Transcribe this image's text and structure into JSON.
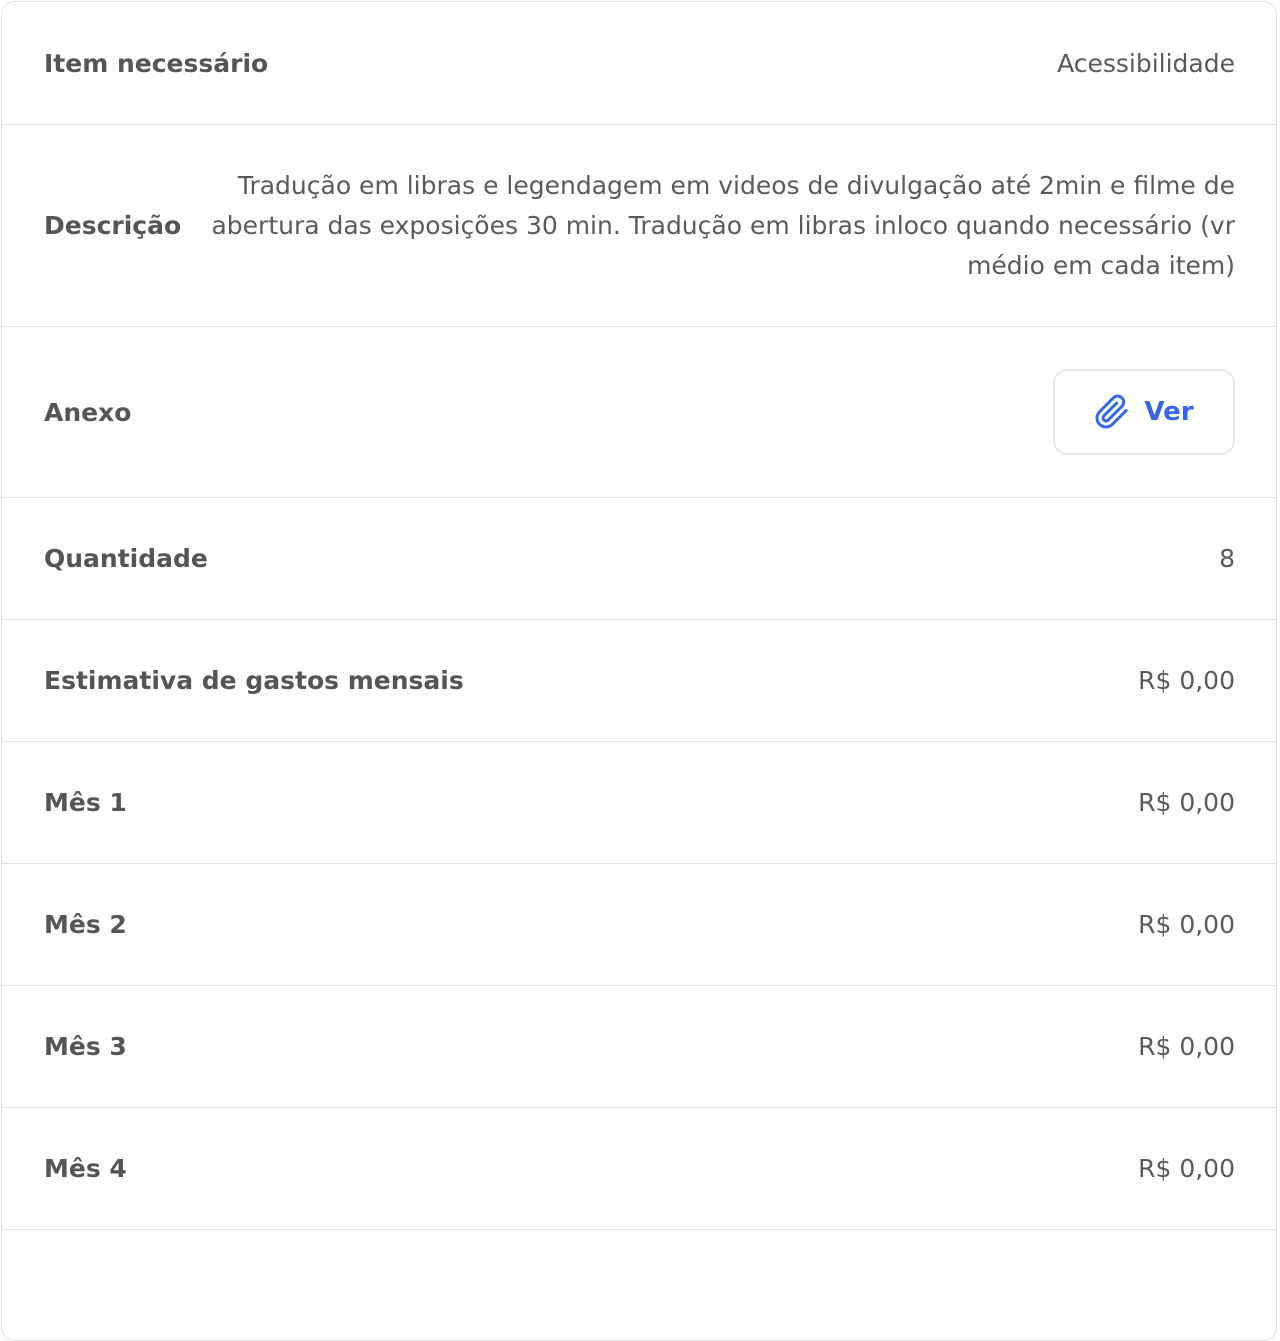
{
  "rows": {
    "item": {
      "label": "Item necessário",
      "value": "Acessibilidade"
    },
    "description": {
      "label": "Descrição",
      "value": "Tradução em libras e legendagem em videos de divulgação até 2min e filme de abertura das exposições 30 min. Tradução em libras inloco quando necessário (vr médio em cada item)"
    },
    "attachment": {
      "label": "Anexo",
      "button_label": "Ver",
      "button_icon": "paperclip-icon"
    },
    "quantity": {
      "label": "Quantidade",
      "value": "8"
    },
    "monthly_estimate": {
      "label": "Estimativa de gastos mensais",
      "value": "R$ 0,00"
    },
    "months": [
      {
        "label": "Mês 1",
        "value": "R$ 0,00"
      },
      {
        "label": "Mês 2",
        "value": "R$ 0,00"
      },
      {
        "label": "Mês 3",
        "value": "R$ 0,00"
      },
      {
        "label": "Mês 4",
        "value": "R$ 0,00"
      }
    ]
  },
  "colors": {
    "accent": "#3567e8",
    "border": "#e0e0e0",
    "label_text": "#555555",
    "value_text": "#5a5a5a"
  }
}
